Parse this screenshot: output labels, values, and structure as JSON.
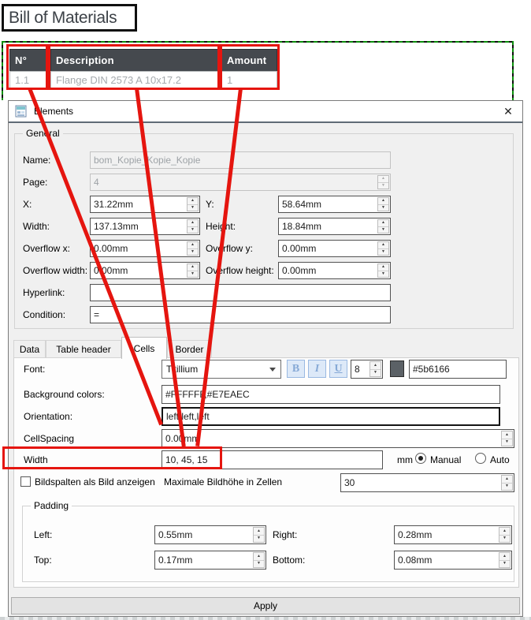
{
  "report": {
    "title_box": "Bill of Materials",
    "table": {
      "columns": [
        {
          "header": "N°",
          "value": "1.1"
        },
        {
          "header": "Description",
          "value": "Flange DIN 2573 A 10x17.2"
        },
        {
          "header": "Amount",
          "value": "1"
        }
      ]
    }
  },
  "dialog": {
    "title": "Elements",
    "general": {
      "legend": "General",
      "name_label": "Name:",
      "name_value": "bom_Kopie_Kopie_Kopie",
      "page_label": "Page:",
      "page_value": "4",
      "x_label": "X:",
      "x_value": "31.22mm",
      "y_label": "Y:",
      "y_value": "58.64mm",
      "width_label": "Width:",
      "width_value": "137.13mm",
      "height_label": "Height:",
      "height_value": "18.84mm",
      "overflow_x_label": "Overflow x:",
      "overflow_x_value": "0.00mm",
      "overflow_y_label": "Overflow y:",
      "overflow_y_value": "0.00mm",
      "overflow_width_label": "Overflow width:",
      "overflow_width_value": "0.00mm",
      "overflow_height_label": "Overflow height:",
      "overflow_height_value": "0.00mm",
      "hyperlink_label": "Hyperlink:",
      "hyperlink_value": "",
      "condition_label": "Condition:",
      "condition_value": "="
    },
    "tabs": {
      "data": "Data",
      "table_header": "Table header",
      "cells": "Cells",
      "border": "Border",
      "active": "Cells"
    },
    "cells_tab": {
      "font_label": "Font:",
      "font_family": "Titillium",
      "bold_label": "B",
      "italic_label": "I",
      "underline_label": "U",
      "font_size": "8",
      "font_color": "#5b6166",
      "background_label": "Background colors:",
      "background_value": "#FFFFFF,#E7EAEC",
      "orientation_label": "Orientation:",
      "orientation_value": "left,left,left",
      "cellspacing_label": "CellSpacing",
      "cellspacing_value": "0.00mm",
      "width_label": "Width",
      "width_value": "10, 45, 15",
      "unit_label": "mm",
      "manual_label": "Manual",
      "manual_selected": true,
      "auto_label": "Auto",
      "image_checkbox_label": "Bildspalten als Bild anzeigen",
      "max_image_height_label": "Maximale Bildhöhe in Zellen",
      "max_image_height_value": "30",
      "padding": {
        "legend": "Padding",
        "left_label": "Left:",
        "left_value": "0.55mm",
        "right_label": "Right:",
        "right_value": "0.28mm",
        "top_label": "Top:",
        "top_value": "0.17mm",
        "bottom_label": "Bottom:",
        "bottom_value": "0.08mm"
      }
    },
    "apply_label": "Apply"
  },
  "icons": {
    "up": "▲",
    "down": "▼",
    "close": "✕"
  },
  "colors": {
    "annotation_red": "#e5150f",
    "selection_green": "#0b8e0b",
    "table_header_bg": "#45494e",
    "font_swatch": "#5b6166"
  }
}
